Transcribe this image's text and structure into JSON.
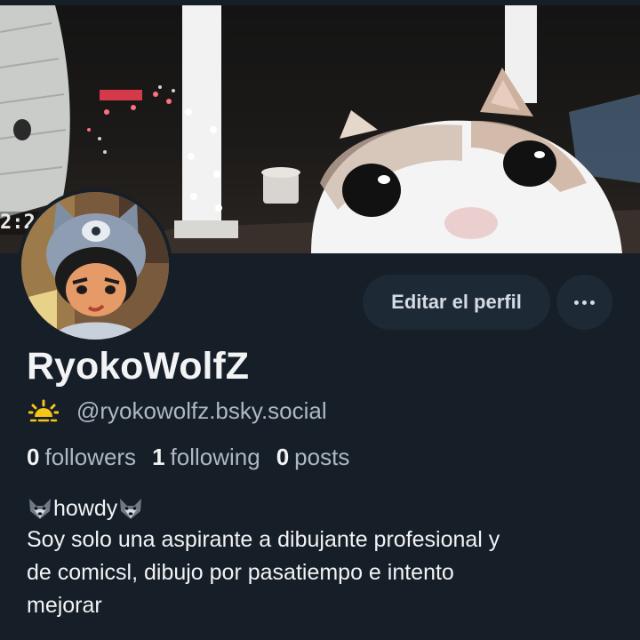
{
  "banner": {
    "timestamp_fragment": "2:2"
  },
  "profile": {
    "display_name": "RyokoWolfZ",
    "handle": "@ryokowolfz.bsky.social",
    "edit_button_label": "Editar el perfil",
    "more_button_icon": "ellipsis-icon",
    "pds_icon": "sunrise-icon"
  },
  "stats": [
    {
      "count": "0",
      "label": "followers"
    },
    {
      "count": "1",
      "label": "following"
    },
    {
      "count": "0",
      "label": "posts"
    }
  ],
  "bio": {
    "greeting": "howdy",
    "greeting_icon": "wolf-face-icon",
    "lines": [
      "Soy solo una aspirante a dibujante profesional y",
      "de comicsl, dibujo por pasatiempo e intento",
      "mejorar"
    ]
  },
  "colors": {
    "background": "#161e27",
    "button_bg": "#1e2936",
    "secondary_text": "#aeb8c4",
    "primary_text": "#f1f3f5"
  }
}
